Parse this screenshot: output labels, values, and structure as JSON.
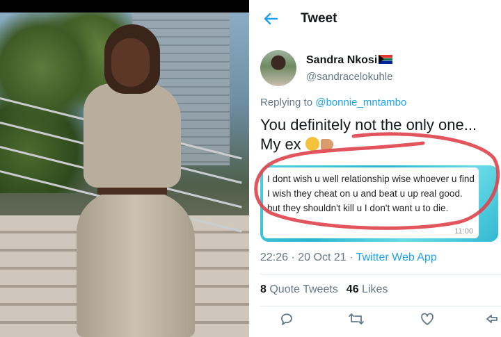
{
  "header": {
    "title": "Tweet",
    "back_icon": "arrow-left-icon"
  },
  "author": {
    "display_name": "Sandra Nkosi",
    "flag_icon": "south-africa-flag-icon",
    "handle": "@sandracelokuhle"
  },
  "reply": {
    "prefix": "Replying to ",
    "to": "@bonnie_mntambo"
  },
  "tweet": {
    "line1": "You definitely not the only one...",
    "line2": "My ex "
  },
  "media": {
    "message": "I dont wish u well relationship wise whoever u find I wish they cheat on u and beat u up real good. but they shouldn't kill u I don't want u to die.",
    "time": "11:00"
  },
  "meta": {
    "time_date": "22:26 · 20 Oct 21 · ",
    "source": "Twitter Web App"
  },
  "stats": {
    "quote_count": "8",
    "quote_label": "Quote Tweets",
    "like_count": "46",
    "like_label": "Likes"
  },
  "actions": [
    "reply-icon",
    "retweet-icon",
    "like-icon",
    "share-icon"
  ],
  "colors": {
    "accent": "#1da1f2",
    "scribble": "#e0424a"
  }
}
